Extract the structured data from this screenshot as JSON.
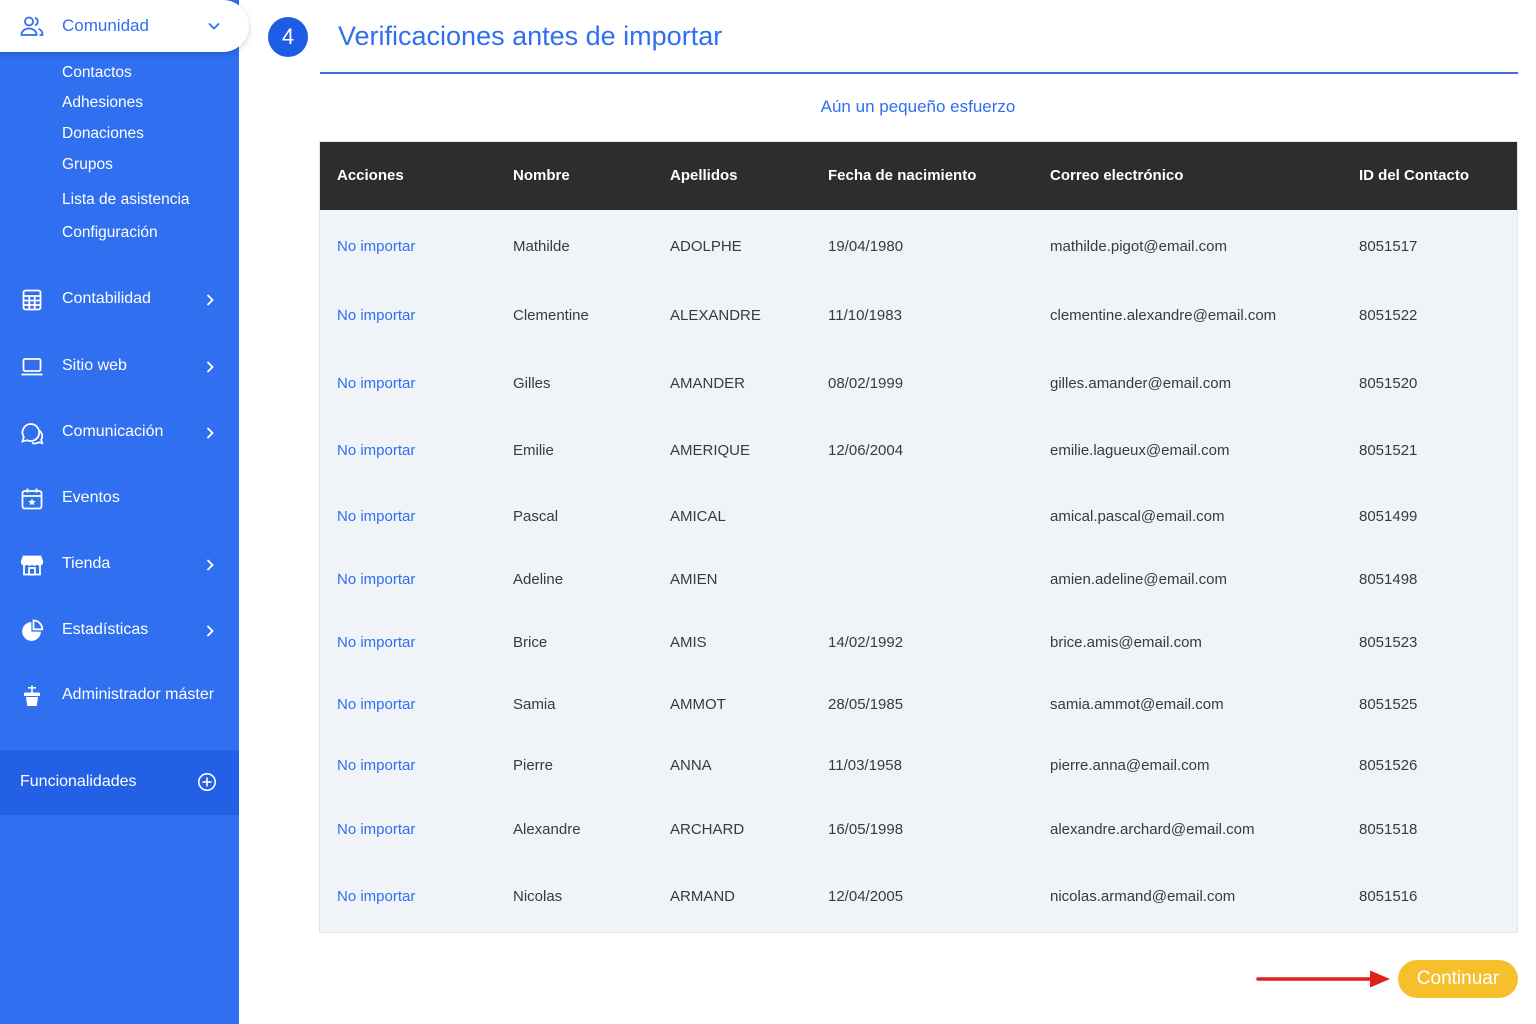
{
  "sidebar": {
    "community": {
      "label": "Comunidad",
      "icon": "users-icon"
    },
    "sub_items": [
      "Contactos",
      "Adhesiones",
      "Donaciones",
      "Grupos",
      "Lista de asistencia",
      "Configuración"
    ],
    "nav": [
      {
        "label": "Contabilidad",
        "icon": "calculator-icon",
        "has_chevron": true
      },
      {
        "label": "Sitio web",
        "icon": "laptop-icon",
        "has_chevron": true
      },
      {
        "label": "Comunicación",
        "icon": "chat-icon",
        "has_chevron": true
      },
      {
        "label": "Eventos",
        "icon": "calendar-icon",
        "has_chevron": false
      },
      {
        "label": "Tienda",
        "icon": "store-icon",
        "has_chevron": true
      },
      {
        "label": "Estadísticas",
        "icon": "pie-chart-icon",
        "has_chevron": true
      },
      {
        "label": "Administrador máster",
        "icon": "admin-icon",
        "has_chevron": false
      }
    ],
    "features": {
      "label": "Funcionalidades",
      "icon": "plus-circle-icon"
    }
  },
  "main": {
    "step_number": "4",
    "title": "Verificaciones antes de importar",
    "subtitle": "Aún un pequeño esfuerzo",
    "table": {
      "headers": [
        "Acciones",
        "Nombre",
        "Apellidos",
        "Fecha de nacimiento",
        "Correo electrónico",
        "ID del Contacto"
      ],
      "rows": [
        [
          "No importar",
          "Mathilde",
          "ADOLPHE",
          "19/04/1980",
          "mathilde.pigot@email.com",
          "8051517"
        ],
        [
          "No importar",
          "Clementine",
          "ALEXANDRE",
          "11/10/1983",
          "clementine.alexandre@email.com",
          "8051522"
        ],
        [
          "No importar",
          "Gilles",
          "AMANDER",
          "08/02/1999",
          "gilles.amander@email.com",
          "8051520"
        ],
        [
          "No importar",
          "Emilie",
          "AMERIQUE",
          "12/06/2004",
          "emilie.lagueux@email.com",
          "8051521"
        ],
        [
          "No importar",
          "Pascal",
          "AMICAL",
          "",
          "amical.pascal@email.com",
          "8051499"
        ],
        [
          "No importar",
          "Adeline",
          "AMIEN",
          "",
          "amien.adeline@email.com",
          "8051498"
        ],
        [
          "No importar",
          "Brice",
          "AMIS",
          "14/02/1992",
          "brice.amis@email.com",
          "8051523"
        ],
        [
          "No importar",
          "Samia",
          "AMMOT",
          "28/05/1985",
          "samia.ammot@email.com",
          "8051525"
        ],
        [
          "No importar",
          "Pierre",
          "ANNA",
          "11/03/1958",
          "pierre.anna@email.com",
          "8051526"
        ],
        [
          "No importar",
          "Alexandre",
          "ARCHARD",
          "16/05/1998",
          "alexandre.archard@email.com",
          "8051518"
        ],
        [
          "No importar",
          "Nicolas",
          "ARMAND",
          "12/04/2005",
          "nicolas.armand@email.com",
          "8051516"
        ]
      ]
    },
    "continue_label": "Continuar"
  },
  "colors": {
    "sidebar_blue": "#2f6ff0",
    "accent_blue": "#2f6ff0",
    "header_dark": "#2d2d2d",
    "table_bg": "#f0f4f9",
    "button_yellow": "#f6bf2c",
    "arrow_red": "#e0201c"
  }
}
